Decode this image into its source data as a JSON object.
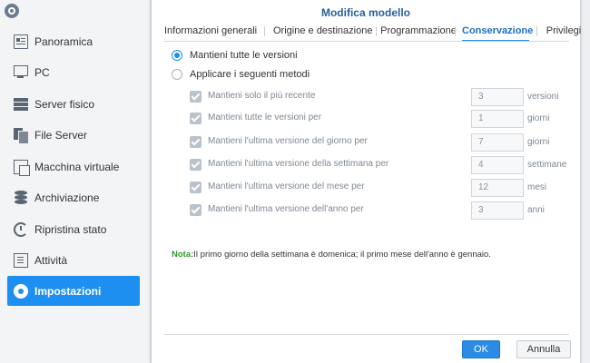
{
  "sidebar": {
    "items": [
      {
        "label": "Panoramica",
        "icon": "overview-icon"
      },
      {
        "label": "PC",
        "icon": "pc-icon"
      },
      {
        "label": "Server fisico",
        "icon": "server-icon"
      },
      {
        "label": "File Server",
        "icon": "file-server-icon"
      },
      {
        "label": "Macchina virtuale",
        "icon": "virtual-machine-icon"
      },
      {
        "label": "Archiviazione",
        "icon": "storage-icon"
      },
      {
        "label": "Ripristina stato",
        "icon": "restore-icon"
      },
      {
        "label": "Attività",
        "icon": "tasks-icon"
      },
      {
        "label": "Impostazioni",
        "icon": "gear-icon",
        "active": true
      }
    ]
  },
  "dialog": {
    "title": "Modifica modello",
    "tabs": [
      {
        "label": "Informazioni generali"
      },
      {
        "label": "Origine e destinazione"
      },
      {
        "label": "Programmazione"
      },
      {
        "label": "Conservazione",
        "active": true
      },
      {
        "label": "Privilegi"
      }
    ],
    "radios": [
      {
        "label": "Mantieni tutte le versioni",
        "checked": true
      },
      {
        "label": "Applicare i seguenti metodi",
        "checked": false
      }
    ],
    "options": [
      {
        "label": "Mantieni solo il più recente",
        "value": "3",
        "unit": "versioni",
        "checked": true
      },
      {
        "label": "Mantieni tutte le versioni per",
        "value": "1",
        "unit": "giorni",
        "checked": true
      },
      {
        "label": "Mantieni l'ultima versione del giorno per",
        "value": "7",
        "unit": "giorni",
        "checked": true
      },
      {
        "label": "Mantieni l'ultima versione della settimana per",
        "value": "4",
        "unit": "settimane",
        "checked": true
      },
      {
        "label": "Mantieni l'ultima versione del mese per",
        "value": "12",
        "unit": "mesi",
        "checked": true
      },
      {
        "label": "Mantieni l'ultima versione dell'anno per",
        "value": "3",
        "unit": "anni",
        "checked": true
      }
    ],
    "note": {
      "label": "Nota:",
      "text": "Il primo giorno della settimana è domenica; il primo mese dell'anno è gennaio."
    },
    "buttons": {
      "ok": "OK",
      "cancel": "Annulla"
    }
  },
  "colors": {
    "accent": "#1d8ff0",
    "title": "#2a5f98",
    "note_label": "#2f9a2f",
    "disabled_text": "#7f8892"
  }
}
